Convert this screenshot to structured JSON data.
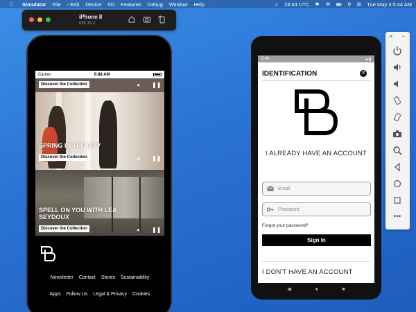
{
  "menubar": {
    "app_name": "Simulator",
    "items": [
      "File",
      "Edit",
      "Device",
      "I/O",
      "Features",
      "Debug",
      "Window",
      "Help"
    ],
    "clock_utc": "23:44 UTC",
    "datetime": "Tue May 3  5:44 AM"
  },
  "simulator": {
    "device_name": "iPhone 8",
    "os_version": "iOS 15.2"
  },
  "iphone": {
    "carrier": "Carrier",
    "time": "6:88 AM",
    "panels": [
      {
        "button": "Discover the Collection",
        "headline": ""
      },
      {
        "button": "Discover the Collection",
        "headline": "SPRING IN THE CITY"
      },
      {
        "button": "Discover the Collection",
        "headline_line1": "SPELL ON YOU WITH LEA",
        "headline_line2": "SEYDOUX"
      }
    ],
    "footer_row1": [
      "Newsletter",
      "Contact",
      "Stores",
      "Sustainability"
    ],
    "footer_row2": [
      "Apps",
      "Follow Us",
      "Legal & Privacy",
      "Cookies"
    ]
  },
  "android": {
    "time": "5:44",
    "title": "IDENTIFICATION",
    "have_account": "I ALREADY HAVE AN ACCOUNT",
    "email_placeholder": "Email",
    "password_placeholder": "Password",
    "forgot": "Forgot your password?",
    "signin": "Sign In",
    "no_account": "I DON'T HAVE AN ACCOUNT"
  },
  "colors": {
    "desktop_blue": "#2a72d4",
    "brand_black": "#000000",
    "traffic_red": "#ff5f57",
    "traffic_yellow": "#febc2e",
    "traffic_green": "#28c840"
  },
  "icons": [
    "apple-icon",
    "wifi-icon",
    "battery-icon",
    "home-icon",
    "screenshot-icon",
    "rotate-icon",
    "close-icon",
    "mail-icon",
    "key-icon",
    "back-icon",
    "home-circle-icon",
    "overview-icon",
    "power-icon",
    "volume-up-icon",
    "volume-down-icon",
    "camera-icon",
    "zoom-icon",
    "more-icon"
  ]
}
